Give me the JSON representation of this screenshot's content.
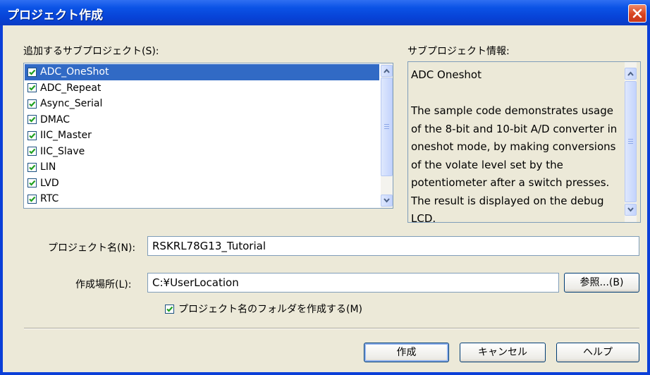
{
  "window": {
    "title": "プロジェクト作成"
  },
  "subprojects": {
    "label": "追加するサブプロジェクト(S):",
    "items": [
      {
        "label": "ADC_OneShot",
        "checked": true,
        "selected": true
      },
      {
        "label": "ADC_Repeat",
        "checked": true
      },
      {
        "label": "Async_Serial",
        "checked": true
      },
      {
        "label": "DMAC",
        "checked": true
      },
      {
        "label": "IIC_Master",
        "checked": true
      },
      {
        "label": "IIC_Slave",
        "checked": true
      },
      {
        "label": "LIN",
        "checked": true
      },
      {
        "label": "LVD",
        "checked": true
      },
      {
        "label": "RTC",
        "checked": true
      }
    ]
  },
  "info": {
    "label": "サブプロジェクト情報:",
    "text": "ADC Oneshot\n\nThe sample code demonstrates usage of the 8-bit and 10-bit A/D converter in oneshot mode, by making conversions of the volate level set by the potentiometer after a switch presses. The result is displayed on the debug LCD."
  },
  "project_name": {
    "label": "プロジェクト名(N):",
    "value": "RSKRL78G13_Tutorial"
  },
  "location": {
    "label": "作成場所(L):",
    "value": "C:¥UserLocation",
    "browse_label": "参照...(B)"
  },
  "create_folder": {
    "label": "プロジェクト名のフォルダを作成する(M)",
    "checked": true
  },
  "buttons": {
    "create": "作成",
    "cancel": "キャンセル",
    "help": "ヘルプ"
  },
  "colors": {
    "title_bar": "#0b53e6",
    "selection": "#316ac5",
    "dialog_bg": "#ece9d8",
    "check_mark": "#21a121"
  }
}
